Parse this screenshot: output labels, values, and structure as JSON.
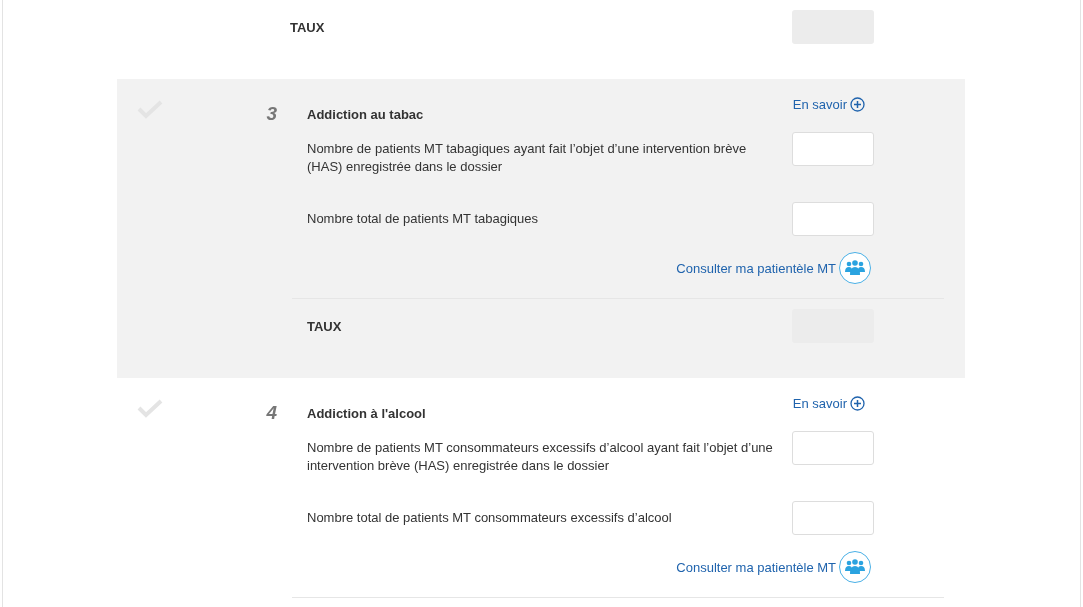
{
  "top_rate": {
    "label": "TAUX",
    "disabled": true
  },
  "sections": [
    {
      "number": "3",
      "selected": true,
      "completed": false,
      "title": "Addiction au tabac",
      "info_link": "En savoir",
      "fields": [
        {
          "label": "Nombre de patients MT tabagiques ayant fait l’objet d’une intervention brève (HAS) enregistrée dans le dossier"
        },
        {
          "label": "Nombre total de patients MT tabagiques"
        }
      ],
      "patients_link": "Consulter ma patientèle MT",
      "rate": {
        "label": "TAUX",
        "disabled": true
      }
    },
    {
      "number": "4",
      "selected": false,
      "completed": false,
      "title": "Addiction à l'alcool",
      "info_link": "En savoir",
      "fields": [
        {
          "label": "Nombre de patients MT consommateurs excessifs d’alcool ayant fait l’objet d’une intervention brève (HAS) enregistrée dans le dossier"
        },
        {
          "label": "Nombre total de patients MT consommateurs excessifs d’alcool"
        }
      ],
      "patients_link": "Consulter ma patientèle MT"
    }
  ]
}
